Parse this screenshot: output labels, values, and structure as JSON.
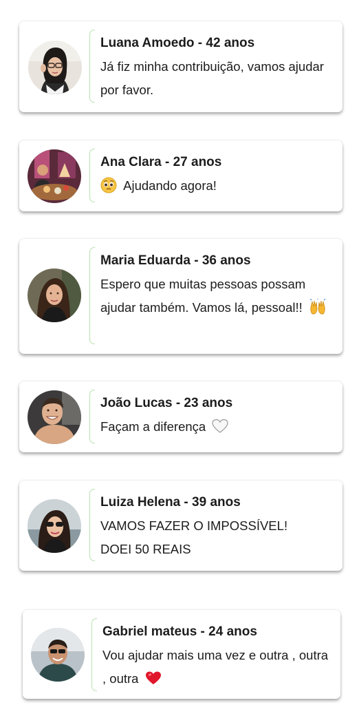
{
  "comments": [
    {
      "name": "Luana Amoedo - 42 anos",
      "message": "Já fiz minha contribuição, vamos ajudar por favor.",
      "avatar": "woman-glasses-avatar"
    },
    {
      "name": "Ana Clara - 27 anos",
      "message": "Ajudando agora!",
      "emoji": "pleading-face-icon",
      "avatar": "party-table-avatar"
    },
    {
      "name": "Maria Eduarda - 36 anos",
      "message": "Espero que muitas pessoas possam ajudar também. Vamos lá, pessoal!!",
      "emoji": "raising-hands-icon",
      "avatar": "woman-long-hair-avatar"
    },
    {
      "name": "João Lucas - 23 anos",
      "message": "Façam a diferença",
      "emoji": "white-heart-icon",
      "avatar": "smiling-man-avatar"
    },
    {
      "name": "Luiza Helena - 39 anos",
      "message": "VAMOS FAZER O IMPOSSÍVEL! DOEI 50 REAIS",
      "avatar": "woman-sunglasses-avatar"
    },
    {
      "name": "Gabriel mateus - 24 anos",
      "message": "Vou ajudar mais uma vez e outra , outra , outra",
      "emoji": "red-heart-icon",
      "avatar": "man-sunglasses-avatar"
    }
  ],
  "colors": {
    "divider": "#b9e2b0",
    "text": "#1c1c1c",
    "heart": "#e0162b"
  }
}
